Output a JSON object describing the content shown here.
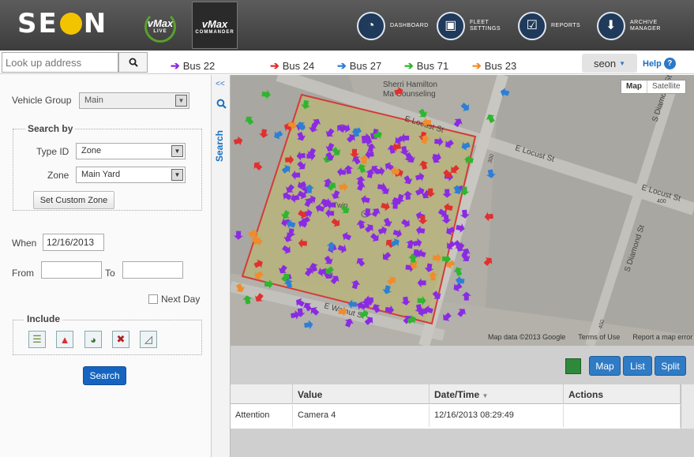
{
  "brand": {
    "logo_left": "SE",
    "logo_right": "N",
    "live_label": "vMax",
    "live_sub": "LIVE",
    "commander_label": "vMax",
    "commander_sub": "COMMANDER"
  },
  "nav": [
    {
      "label": "DASHBOARD",
      "icon": "gauge-icon"
    },
    {
      "label": "FLEET\nSETTINGS",
      "icon": "bus-icon"
    },
    {
      "label": "REPORTS",
      "icon": "clipboard-icon"
    },
    {
      "label": "ARCHIVE\nMANAGER",
      "icon": "download-icon"
    }
  ],
  "search": {
    "placeholder": "Look up address"
  },
  "buses": [
    {
      "label": "Bus 22",
      "color": "#8a2be2"
    },
    {
      "label": "Bus 24",
      "color": "#e03030"
    },
    {
      "label": "Bus 27",
      "color": "#2d7fd6"
    },
    {
      "label": "Bus 71",
      "color": "#2fb52f"
    },
    {
      "label": "Bus 23",
      "color": "#f08c2a"
    }
  ],
  "user": {
    "name": "seon",
    "help": "Help"
  },
  "panel": {
    "vehicle_group_label": "Vehicle Group",
    "vehicle_group_value": "Main",
    "search_by_legend": "Search by",
    "type_id_label": "Type ID",
    "type_id_value": "Zone",
    "zone_label": "Zone",
    "zone_value": "Main Yard",
    "custom_zone_button": "Set Custom Zone",
    "when_label": "When",
    "when_value": "12/16/2013",
    "from_label": "From",
    "to_label": "To",
    "next_day_label": "Next Day",
    "include_legend": "Include",
    "search_button": "Search"
  },
  "sidetab": {
    "collapse": "<<",
    "search_label": "Search"
  },
  "map": {
    "map_button": "Map",
    "satellite_button": "Satellite",
    "streets": [
      "E Locust St",
      "E Locust St",
      "E Locust St",
      "E Walnut St",
      "S Diamond St",
      "S Diamond St",
      "400",
      "400",
      "300"
    ],
    "places": [
      "Sherri Hamilton",
      "Ma Counseling",
      "Twin"
    ],
    "attribution": "Map data ©2013 Google",
    "terms": "Terms of Use",
    "report": "Report a map error"
  },
  "view_buttons": [
    "Map",
    "List",
    "Split"
  ],
  "table": {
    "headers": [
      "Value",
      "Date/Time",
      "Actions"
    ],
    "row": {
      "event": "Attention",
      "value": "Camera 4",
      "datetime": "12/16/2013 08:29:49",
      "actions": ""
    }
  }
}
